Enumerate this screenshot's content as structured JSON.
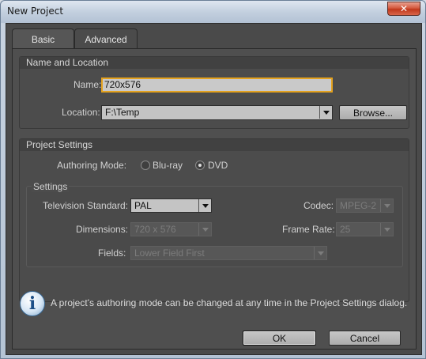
{
  "window": {
    "title": "New Project",
    "close_glyph": "✕",
    "close_icon": "close-icon"
  },
  "tabs": [
    {
      "label": "Basic",
      "active": true
    },
    {
      "label": "Advanced",
      "active": false
    }
  ],
  "name_location": {
    "heading": "Name and Location",
    "name_label": "Name:",
    "name_value": "720x576",
    "location_label": "Location:",
    "location_value": "F:\\Temp",
    "browse_label": "Browse..."
  },
  "project_settings": {
    "heading": "Project Settings",
    "authoring_label": "Authoring Mode:",
    "options": [
      {
        "label": "Blu-ray",
        "checked": false
      },
      {
        "label": "DVD",
        "checked": true
      }
    ],
    "settings": {
      "heading": "Settings",
      "tv_standard_label": "Television Standard:",
      "tv_standard_value": "PAL",
      "codec_label": "Codec:",
      "codec_value": "MPEG-2",
      "dimensions_label": "Dimensions:",
      "dimensions_value": "720 x 576",
      "frame_rate_label": "Frame Rate:",
      "frame_rate_value": "25",
      "fields_label": "Fields:",
      "fields_value": "Lower Field First"
    }
  },
  "info": {
    "icon": "info-icon",
    "glyph": "i",
    "message": "A project's authoring mode can be changed at any time in the Project Settings dialog."
  },
  "buttons": {
    "ok": "OK",
    "cancel": "Cancel"
  },
  "colors": {
    "panel": "#4a4a4a",
    "focus_border": "#e4a21f",
    "titlebar": "#c3d0df"
  }
}
